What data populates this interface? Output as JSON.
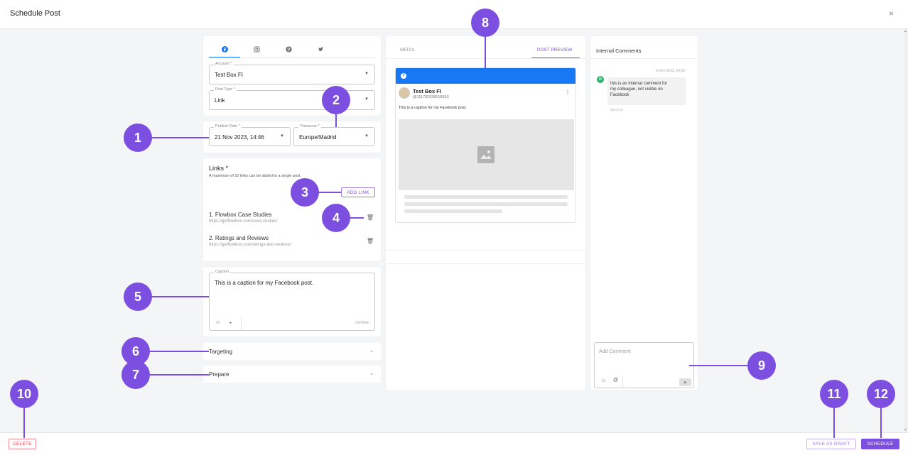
{
  "window": {
    "title": "Schedule Post",
    "close_glyph": "×"
  },
  "tabs": [
    "facebook-icon",
    "instagram-icon",
    "pinterest-icon",
    "twitter-icon"
  ],
  "account": {
    "label": "Account *",
    "value": "Test Box FI"
  },
  "post_type": {
    "label": "Post Type *",
    "value": "Link"
  },
  "publish_date": {
    "label": "Publish Date *",
    "value": "21 Nov 2023, 14:46"
  },
  "timezone": {
    "label": "Timezone *",
    "value": "Europe/Madrid"
  },
  "links": {
    "title": "Links *",
    "hint": "A maximum of 10 links can be added to a single post.",
    "add_label": "ADD LINK",
    "items": [
      {
        "title": "1. Flowbox Case Studies",
        "url": "https://getflowbox.com/case-studies/"
      },
      {
        "title": "2. Ratings and Reviews",
        "url": "https://getflowbox.com/ratings-and-reviews/"
      }
    ]
  },
  "caption": {
    "label": "Caption",
    "value": "This is a caption for my Facebook post.",
    "counter": "39/8000"
  },
  "targeting": {
    "label": "Targeting"
  },
  "prepare": {
    "label": "Prepare"
  },
  "preview": {
    "tab_media": "MEDIA",
    "tab_post_preview": "POST PREVIEW",
    "account_name": "Test Box FI",
    "account_id": "@111782938518663",
    "caption": "This is a caption for my Facebook post."
  },
  "comments": {
    "title": "Internal Comments",
    "timestamp": "3 Nov 2023, 14:33",
    "avatar_initial": "B",
    "text": "this is an internal comment for my colleague, not visible on Facebook",
    "delete_label": "DELETE",
    "add_placeholder": "Add Comment"
  },
  "footer": {
    "delete_label": "DELETE",
    "draft_label": "SAVE AS DRAFT",
    "schedule_label": "SCHEDULE"
  },
  "callouts": [
    "1",
    "2",
    "3",
    "4",
    "5",
    "6",
    "7",
    "8",
    "9",
    "10",
    "11",
    "12"
  ],
  "colors": {
    "accent": "#7d4fe0",
    "facebook_blue": "#1877f2",
    "danger": "#e74c5e"
  }
}
